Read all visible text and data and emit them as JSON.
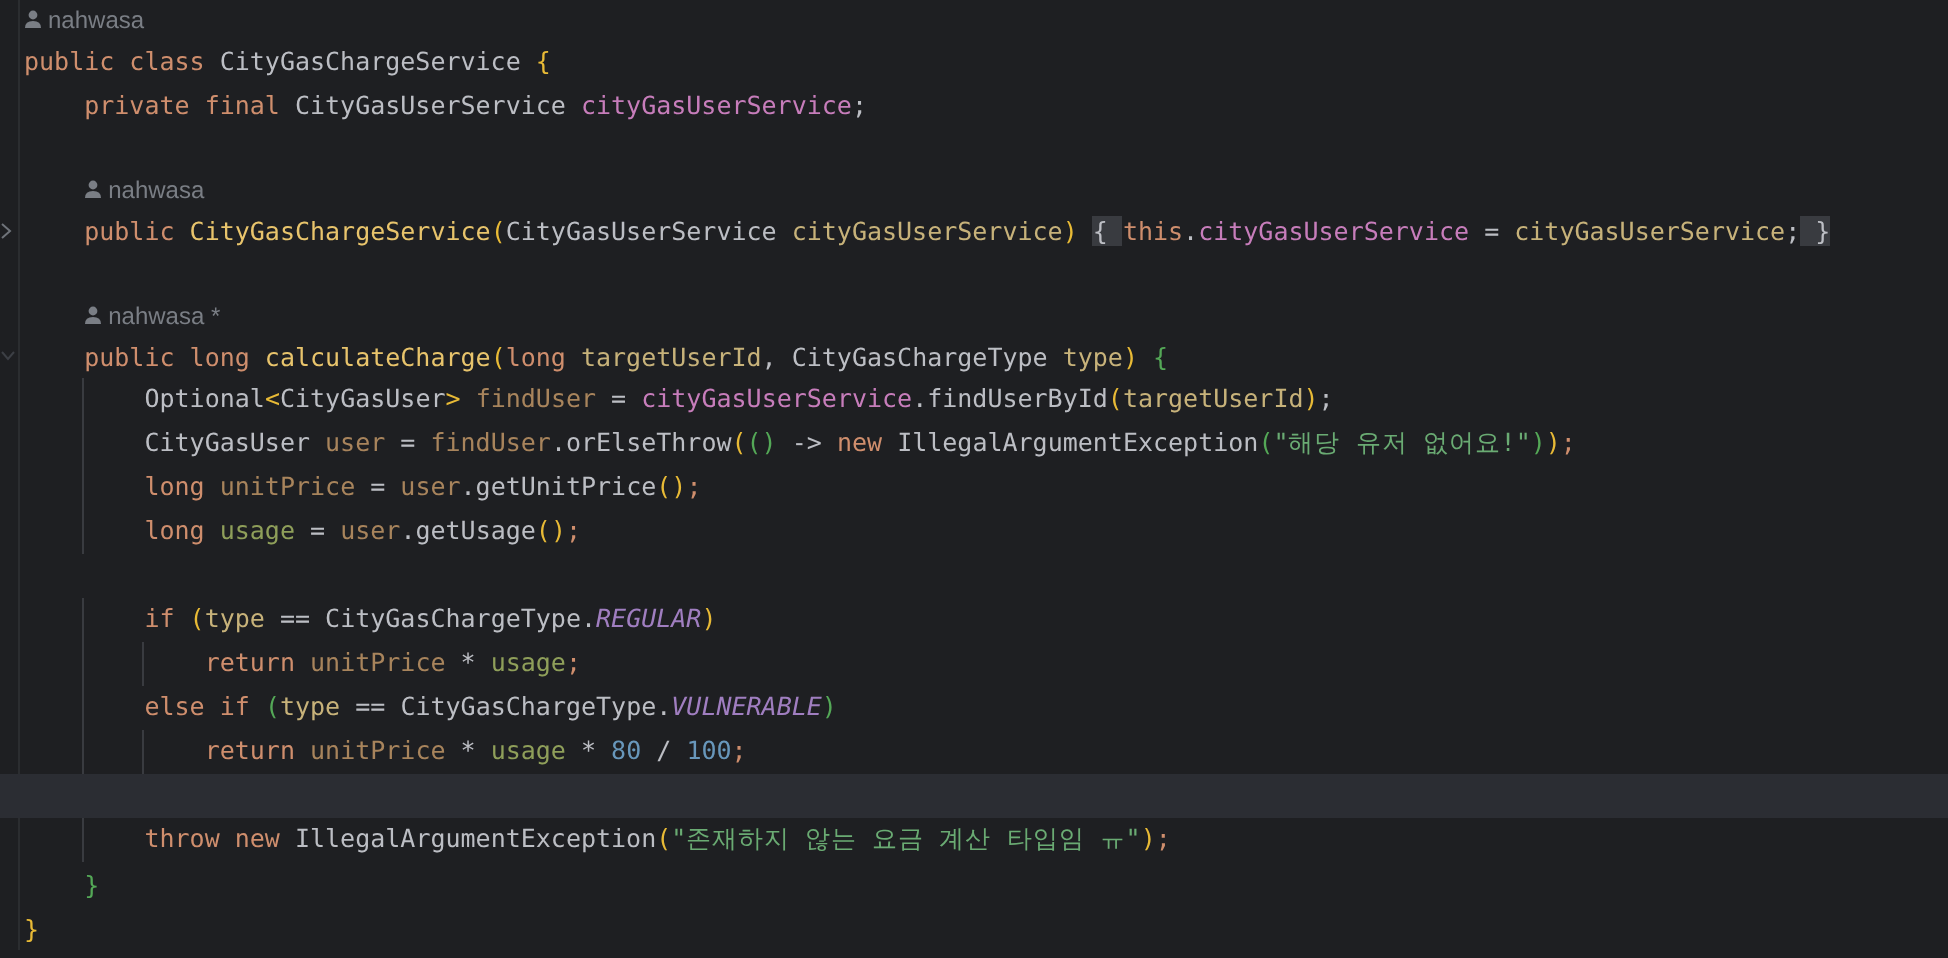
{
  "editor": {
    "lines": [
      {
        "kind": "author",
        "indented": false,
        "author": "nahwasa"
      },
      {
        "kind": "code",
        "tokens": [
          {
            "kind": "kw",
            "t": "public class "
          },
          {
            "kind": "type",
            "t": "CityGasChargeService "
          },
          {
            "kind": "br1",
            "t": "{"
          }
        ]
      },
      {
        "kind": "code",
        "tokens": [
          {
            "kind": "kw",
            "t": "    private final "
          },
          {
            "kind": "type",
            "t": "CityGasUserService "
          },
          {
            "kind": "field",
            "t": "cityGasUserService"
          },
          {
            "kind": "op",
            "t": ";"
          }
        ]
      },
      {
        "kind": "blank"
      },
      {
        "kind": "author",
        "indented": true,
        "author": "nahwasa"
      },
      {
        "kind": "code",
        "fold": {
          "kind": "collapsed"
        },
        "tokens": [
          {
            "kind": "kw",
            "t": "    public "
          },
          {
            "kind": "decl",
            "t": "CityGasChargeService"
          },
          {
            "kind": "br1",
            "t": "("
          },
          {
            "kind": "type",
            "t": "CityGasUserService "
          },
          {
            "kind": "param",
            "t": "cityGasUserService"
          },
          {
            "kind": "br1",
            "t": ") "
          },
          {
            "kind": "fold",
            "t": "{ "
          },
          {
            "kind": "kw",
            "t": "this"
          },
          {
            "kind": "op",
            "t": "."
          },
          {
            "kind": "field",
            "t": "cityGasUserService"
          },
          {
            "kind": "op",
            "t": " = "
          },
          {
            "kind": "param",
            "t": "cityGasUserService"
          },
          {
            "kind": "op",
            "t": ";"
          },
          {
            "kind": "fold",
            "t": " }"
          }
        ]
      },
      {
        "kind": "blank"
      },
      {
        "kind": "author",
        "indented": true,
        "author": "nahwasa *"
      },
      {
        "kind": "code",
        "fold": {
          "kind": "expanded"
        },
        "tokens": [
          {
            "kind": "kw",
            "t": "    public long "
          },
          {
            "kind": "decl",
            "t": "calculateCharge"
          },
          {
            "kind": "br1",
            "t": "("
          },
          {
            "kind": "kw",
            "t": "long "
          },
          {
            "kind": "param",
            "t": "targetUserId"
          },
          {
            "kind": "op",
            "t": ", "
          },
          {
            "kind": "type",
            "t": "CityGasChargeType "
          },
          {
            "kind": "param",
            "t": "type"
          },
          {
            "kind": "br1",
            "t": ") "
          },
          {
            "kind": "br2",
            "t": "{"
          }
        ]
      },
      {
        "kind": "code",
        "tokens": [
          {
            "kind": "type",
            "t": "        Optional"
          },
          {
            "kind": "br1",
            "t": "<"
          },
          {
            "kind": "type",
            "t": "CityGasUser"
          },
          {
            "kind": "br1",
            "t": ">"
          },
          {
            "kind": "var",
            "t": " findUser"
          },
          {
            "kind": "op",
            "t": " = "
          },
          {
            "kind": "field",
            "t": "cityGasUserService"
          },
          {
            "kind": "op",
            "t": ".findUserById"
          },
          {
            "kind": "br1",
            "t": "("
          },
          {
            "kind": "param",
            "t": "targetUserId"
          },
          {
            "kind": "br1",
            "t": ")"
          },
          {
            "kind": "op",
            "t": ";"
          }
        ]
      },
      {
        "kind": "code",
        "tokens": [
          {
            "kind": "type",
            "t": "        CityGasUser "
          },
          {
            "kind": "var",
            "t": "user"
          },
          {
            "kind": "op",
            "t": " = "
          },
          {
            "kind": "var",
            "t": "findUser"
          },
          {
            "kind": "op",
            "t": ".orElseThrow"
          },
          {
            "kind": "br1",
            "t": "("
          },
          {
            "kind": "br2",
            "t": "()"
          },
          {
            "kind": "op",
            "t": " -> "
          },
          {
            "kind": "kw",
            "t": "new "
          },
          {
            "kind": "type",
            "t": "IllegalArgumentException"
          },
          {
            "kind": "br2",
            "t": "("
          },
          {
            "kind": "str",
            "t": "\"해당 유저 없어요!\""
          },
          {
            "kind": "br2",
            "t": ")"
          },
          {
            "kind": "br1",
            "t": ")"
          },
          {
            "kind": "kw",
            "t": ";"
          }
        ]
      },
      {
        "kind": "code",
        "tokens": [
          {
            "kind": "kw",
            "t": "        long "
          },
          {
            "kind": "var",
            "t": "unitPrice"
          },
          {
            "kind": "op",
            "t": " = "
          },
          {
            "kind": "var",
            "t": "user"
          },
          {
            "kind": "op",
            "t": ".getUnitPrice"
          },
          {
            "kind": "br1",
            "t": "()"
          },
          {
            "kind": "kw",
            "t": ";"
          }
        ]
      },
      {
        "kind": "code",
        "tokens": [
          {
            "kind": "kw",
            "t": "        long "
          },
          {
            "kind": "var2",
            "t": "usage"
          },
          {
            "kind": "op",
            "t": " = "
          },
          {
            "kind": "var",
            "t": "user"
          },
          {
            "kind": "op",
            "t": ".getUsage"
          },
          {
            "kind": "br1",
            "t": "()"
          },
          {
            "kind": "kw",
            "t": ";"
          }
        ]
      },
      {
        "kind": "blank"
      },
      {
        "kind": "code",
        "tokens": [
          {
            "kind": "kw",
            "t": "        if "
          },
          {
            "kind": "br1",
            "t": "("
          },
          {
            "kind": "param",
            "t": "type"
          },
          {
            "kind": "op",
            "t": " == "
          },
          {
            "kind": "type",
            "t": "CityGasChargeType."
          },
          {
            "kind": "enum",
            "t": "REGULAR"
          },
          {
            "kind": "br1",
            "t": ")"
          }
        ]
      },
      {
        "kind": "code",
        "tokens": [
          {
            "kind": "kw",
            "t": "            return "
          },
          {
            "kind": "var",
            "t": "unitPrice"
          },
          {
            "kind": "op",
            "t": " * "
          },
          {
            "kind": "var2",
            "t": "usage"
          },
          {
            "kind": "kw",
            "t": ";"
          }
        ]
      },
      {
        "kind": "code",
        "tokens": [
          {
            "kind": "kw",
            "t": "        else if "
          },
          {
            "kind": "br2",
            "t": "("
          },
          {
            "kind": "param",
            "t": "type"
          },
          {
            "kind": "op",
            "t": " == "
          },
          {
            "kind": "type",
            "t": "CityGasChargeType."
          },
          {
            "kind": "enum",
            "t": "VULNERABLE"
          },
          {
            "kind": "br2",
            "t": ")"
          }
        ]
      },
      {
        "kind": "code",
        "tokens": [
          {
            "kind": "kw",
            "t": "            return "
          },
          {
            "kind": "var",
            "t": "unitPrice"
          },
          {
            "kind": "op",
            "t": " * "
          },
          {
            "kind": "var2",
            "t": "usage"
          },
          {
            "kind": "op",
            "t": " * "
          },
          {
            "kind": "num",
            "t": "80"
          },
          {
            "kind": "op",
            "t": " / "
          },
          {
            "kind": "num",
            "t": "100"
          },
          {
            "kind": "kw",
            "t": ";"
          }
        ]
      },
      {
        "kind": "blank",
        "highlighted": true
      },
      {
        "kind": "code",
        "tokens": [
          {
            "kind": "kw",
            "t": "        throw new "
          },
          {
            "kind": "type",
            "t": "IllegalArgumentException"
          },
          {
            "kind": "br1",
            "t": "("
          },
          {
            "kind": "str",
            "t": "\"존재하지 않는 요금 계산 타입임 ㅠ\""
          },
          {
            "kind": "br1",
            "t": ")"
          },
          {
            "kind": "kw",
            "t": ";"
          }
        ]
      },
      {
        "kind": "code",
        "tokens": [
          {
            "kind": "br2",
            "t": "    }"
          }
        ]
      },
      {
        "kind": "code",
        "tokens": [
          {
            "kind": "br1",
            "t": "}"
          }
        ]
      }
    ]
  }
}
